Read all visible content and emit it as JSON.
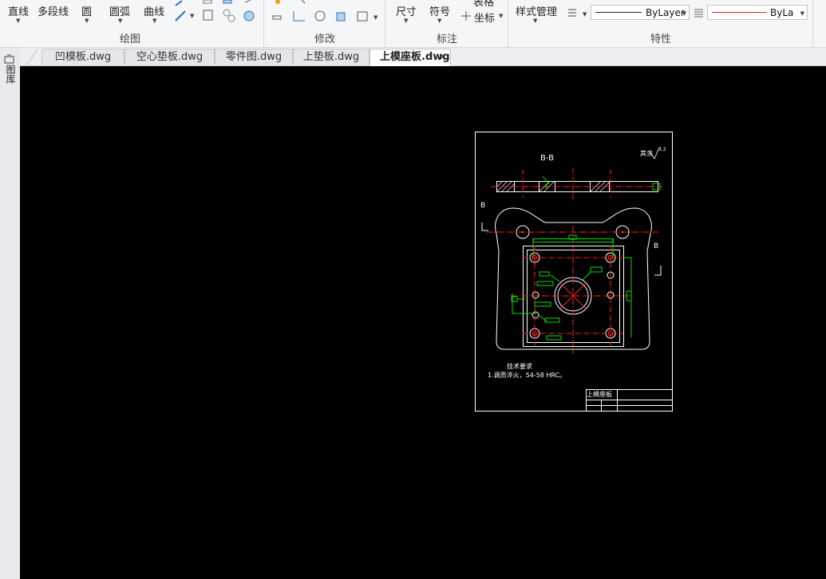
{
  "ribbon": {
    "draw": {
      "line_label": "直线",
      "polyline_label": "多段线",
      "circle_label": "圆",
      "arc_label": "圆弧",
      "curve_label": "曲线",
      "group_label": "绘图"
    },
    "modify": {
      "group_label": "修改"
    },
    "annotate": {
      "dimension_label": "尺寸",
      "symbol_label": "符号",
      "table_label": "表格",
      "coordinate_label": "坐标",
      "group_label": "标注"
    },
    "properties": {
      "style_manager_label": "样式管理",
      "linetype_value": "ByLayer",
      "color_value": "ByLayer",
      "group_label": "特性"
    }
  },
  "tabs": [
    {
      "label": "凹模板.dwg",
      "active": false
    },
    {
      "label": "空心垫板.dwg",
      "active": false
    },
    {
      "label": "零件图.dwg",
      "active": false
    },
    {
      "label": "上垫板.dwg",
      "active": false
    },
    {
      "label": "上模座板.dwg",
      "active": true
    }
  ],
  "sidebar": {
    "label": "图库"
  },
  "drawing": {
    "section_label": "B-B",
    "section_mark_left": "B",
    "section_mark_right": "B",
    "roughness_text": "其余",
    "roughness_value": "3.2",
    "tech_req_title": "技术要求",
    "tech_req_item": "1.调质淬火，54-58 HRC。",
    "title_block_name": "上模座板",
    "colors": {
      "white": "#ffffff",
      "red": "#ff2020",
      "green": "#00e000"
    }
  }
}
